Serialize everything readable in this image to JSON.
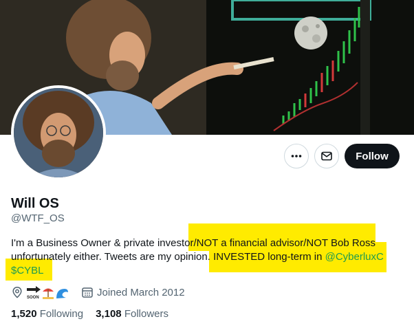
{
  "profile": {
    "name": "Will OS",
    "handle": "@WTF_OS",
    "bio": {
      "line1_plain": "I'm a Business Owner & private investor",
      "line1_highlighted": "/NOT a financial advisor/NOT Bob Ross",
      "line2_plain": "unfortunately either. Tweets are my opinion. ",
      "line2_highlighted": "INVESTED long-term in ",
      "mention": "@CyberluxC",
      "cashtag": "$CYBL"
    },
    "location_emoji": "soon-arrow beach-umbrella wave",
    "joined": "Joined March 2012",
    "following_count": "1,520",
    "following_label": "Following",
    "followers_count": "3,108",
    "followers_label": "Followers"
  },
  "actions": {
    "follow_label": "Follow"
  },
  "colors": {
    "highlight": "#ffeb00",
    "link": "#1d9b50",
    "follow_bg": "#0f1419"
  }
}
